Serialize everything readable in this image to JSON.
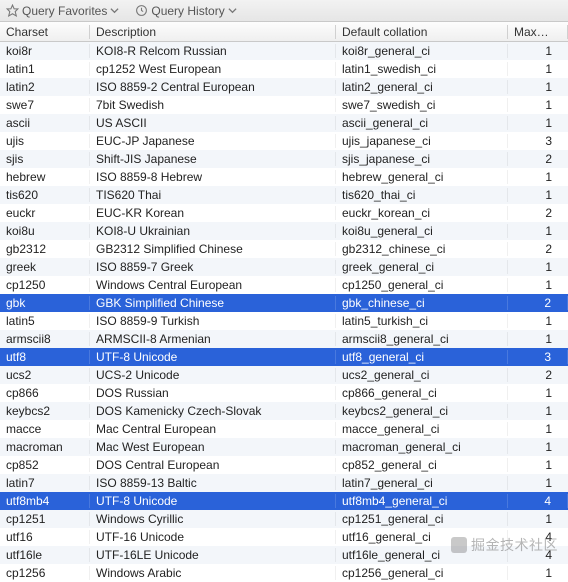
{
  "toolbar": {
    "favorites_label": "Query Favorites",
    "history_label": "Query History"
  },
  "columns": {
    "charset": "Charset",
    "description": "Description",
    "collation": "Default collation",
    "maxlen": "Maxlen"
  },
  "rows": [
    {
      "charset": "koi8r",
      "desc": "KOI8-R Relcom Russian",
      "coll": "koi8r_general_ci",
      "maxlen": "1",
      "selected": false
    },
    {
      "charset": "latin1",
      "desc": "cp1252 West European",
      "coll": "latin1_swedish_ci",
      "maxlen": "1",
      "selected": false
    },
    {
      "charset": "latin2",
      "desc": "ISO 8859-2 Central European",
      "coll": "latin2_general_ci",
      "maxlen": "1",
      "selected": false
    },
    {
      "charset": "swe7",
      "desc": "7bit Swedish",
      "coll": "swe7_swedish_ci",
      "maxlen": "1",
      "selected": false
    },
    {
      "charset": "ascii",
      "desc": "US ASCII",
      "coll": "ascii_general_ci",
      "maxlen": "1",
      "selected": false
    },
    {
      "charset": "ujis",
      "desc": "EUC-JP Japanese",
      "coll": "ujis_japanese_ci",
      "maxlen": "3",
      "selected": false
    },
    {
      "charset": "sjis",
      "desc": "Shift-JIS Japanese",
      "coll": "sjis_japanese_ci",
      "maxlen": "2",
      "selected": false
    },
    {
      "charset": "hebrew",
      "desc": "ISO 8859-8 Hebrew",
      "coll": "hebrew_general_ci",
      "maxlen": "1",
      "selected": false
    },
    {
      "charset": "tis620",
      "desc": "TIS620 Thai",
      "coll": "tis620_thai_ci",
      "maxlen": "1",
      "selected": false
    },
    {
      "charset": "euckr",
      "desc": "EUC-KR Korean",
      "coll": "euckr_korean_ci",
      "maxlen": "2",
      "selected": false
    },
    {
      "charset": "koi8u",
      "desc": "KOI8-U Ukrainian",
      "coll": "koi8u_general_ci",
      "maxlen": "1",
      "selected": false
    },
    {
      "charset": "gb2312",
      "desc": "GB2312 Simplified Chinese",
      "coll": "gb2312_chinese_ci",
      "maxlen": "2",
      "selected": false
    },
    {
      "charset": "greek",
      "desc": "ISO 8859-7 Greek",
      "coll": "greek_general_ci",
      "maxlen": "1",
      "selected": false
    },
    {
      "charset": "cp1250",
      "desc": "Windows Central European",
      "coll": "cp1250_general_ci",
      "maxlen": "1",
      "selected": false
    },
    {
      "charset": "gbk",
      "desc": "GBK Simplified Chinese",
      "coll": "gbk_chinese_ci",
      "maxlen": "2",
      "selected": true
    },
    {
      "charset": "latin5",
      "desc": "ISO 8859-9 Turkish",
      "coll": "latin5_turkish_ci",
      "maxlen": "1",
      "selected": false
    },
    {
      "charset": "armscii8",
      "desc": "ARMSCII-8 Armenian",
      "coll": "armscii8_general_ci",
      "maxlen": "1",
      "selected": false
    },
    {
      "charset": "utf8",
      "desc": "UTF-8 Unicode",
      "coll": "utf8_general_ci",
      "maxlen": "3",
      "selected": true
    },
    {
      "charset": "ucs2",
      "desc": "UCS-2 Unicode",
      "coll": "ucs2_general_ci",
      "maxlen": "2",
      "selected": false
    },
    {
      "charset": "cp866",
      "desc": "DOS Russian",
      "coll": "cp866_general_ci",
      "maxlen": "1",
      "selected": false
    },
    {
      "charset": "keybcs2",
      "desc": "DOS Kamenicky Czech-Slovak",
      "coll": "keybcs2_general_ci",
      "maxlen": "1",
      "selected": false
    },
    {
      "charset": "macce",
      "desc": "Mac Central European",
      "coll": "macce_general_ci",
      "maxlen": "1",
      "selected": false
    },
    {
      "charset": "macroman",
      "desc": "Mac West European",
      "coll": "macroman_general_ci",
      "maxlen": "1",
      "selected": false
    },
    {
      "charset": "cp852",
      "desc": "DOS Central European",
      "coll": "cp852_general_ci",
      "maxlen": "1",
      "selected": false
    },
    {
      "charset": "latin7",
      "desc": "ISO 8859-13 Baltic",
      "coll": "latin7_general_ci",
      "maxlen": "1",
      "selected": false
    },
    {
      "charset": "utf8mb4",
      "desc": "UTF-8 Unicode",
      "coll": "utf8mb4_general_ci",
      "maxlen": "4",
      "selected": true
    },
    {
      "charset": "cp1251",
      "desc": "Windows Cyrillic",
      "coll": "cp1251_general_ci",
      "maxlen": "1",
      "selected": false
    },
    {
      "charset": "utf16",
      "desc": "UTF-16 Unicode",
      "coll": "utf16_general_ci",
      "maxlen": "4",
      "selected": false
    },
    {
      "charset": "utf16le",
      "desc": "UTF-16LE Unicode",
      "coll": "utf16le_general_ci",
      "maxlen": "4",
      "selected": false
    },
    {
      "charset": "cp1256",
      "desc": "Windows Arabic",
      "coll": "cp1256_general_ci",
      "maxlen": "1",
      "selected": false
    }
  ],
  "watermark": "掘金技术社区"
}
